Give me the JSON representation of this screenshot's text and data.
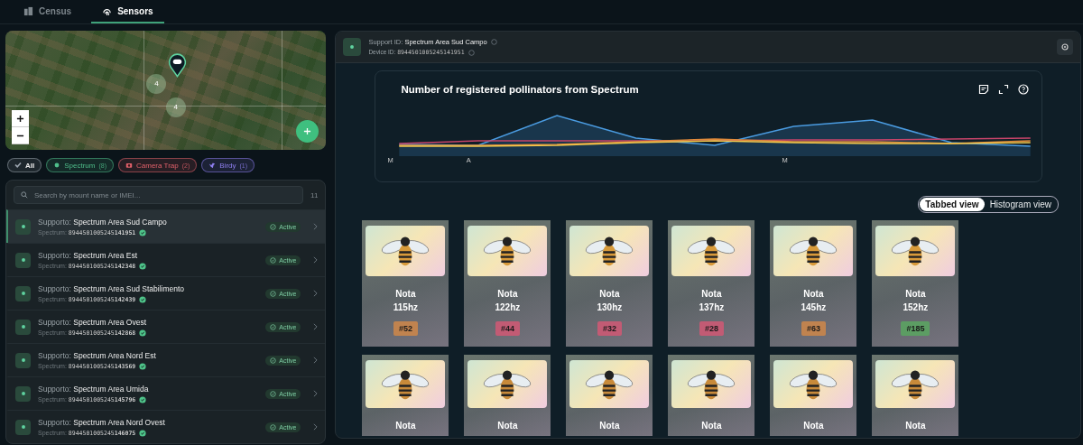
{
  "tabs": [
    {
      "label": "Census",
      "selected": false
    },
    {
      "label": "Sensors",
      "selected": true
    }
  ],
  "map": {
    "clusters": [
      "4",
      "4"
    ]
  },
  "filters": [
    {
      "label": "All",
      "selected": true,
      "kind": "all",
      "color": "#9aa3ad"
    },
    {
      "label": "Spectrum",
      "count": "(8)",
      "selected": false,
      "kind": "spectrum",
      "color": "#4fbf8a"
    },
    {
      "label": "Camera Trap",
      "count": "(2)",
      "selected": false,
      "kind": "camera",
      "color": "#e2616b"
    },
    {
      "label": "Birdy",
      "count": "(1)",
      "selected": false,
      "kind": "bird",
      "color": "#8f7ff0"
    }
  ],
  "search": {
    "placeholder": "Search by mount name or IMEI...",
    "count": "11"
  },
  "sensors": [
    {
      "prefix": "Supporto:",
      "name": "Spectrum Area Sud Campo",
      "type": "Spectrum:",
      "imei_head": "8944501005245",
      "imei_tail": "141951",
      "status": "Active",
      "selected": true
    },
    {
      "prefix": "Supporto:",
      "name": "Spectrum Area Est",
      "type": "Spectrum:",
      "imei_head": "8944501005245",
      "imei_tail": "142348",
      "status": "Active",
      "selected": false
    },
    {
      "prefix": "Supporto:",
      "name": "Spectrum Area Sud Stabilimento",
      "type": "Spectrum:",
      "imei_head": "8944501005245",
      "imei_tail": "142439",
      "status": "Active",
      "selected": false
    },
    {
      "prefix": "Supporto:",
      "name": "Spectrum Area Ovest",
      "type": "Spectrum:",
      "imei_head": "8944501005245",
      "imei_tail": "142868",
      "status": "Active",
      "selected": false
    },
    {
      "prefix": "Supporto:",
      "name": "Spectrum Area Nord Est",
      "type": "Spectrum:",
      "imei_head": "8944501005245",
      "imei_tail": "143569",
      "status": "Active",
      "selected": false
    },
    {
      "prefix": "Supporto:",
      "name": "Spectrum Area Umida",
      "type": "Spectrum:",
      "imei_head": "8944501005245",
      "imei_tail": "145796",
      "status": "Active",
      "selected": false
    },
    {
      "prefix": "Supporto:",
      "name": "Spectrum Area Nord Ovest",
      "type": "Spectrum:",
      "imei_head": "8944501005245",
      "imei_tail": "146075",
      "status": "Active",
      "selected": false
    }
  ],
  "detail": {
    "support_label": "Support ID:",
    "support_value": "Spectrum Area Sud Campo",
    "device_label": "Device ID:",
    "device_value": "8944501005245141951"
  },
  "chart": {
    "title": "Number of registered pollinators from Spectrum",
    "x_labels": [
      "M",
      "A",
      "M"
    ]
  },
  "views": [
    {
      "label": "Tabbed view",
      "selected": true
    },
    {
      "label": "Histogram view",
      "selected": false
    }
  ],
  "cards": [
    {
      "name": "Nota",
      "freq": "115hz",
      "count": "#52",
      "color": "#c0834f"
    },
    {
      "name": "Nota",
      "freq": "122hz",
      "count": "#44",
      "color": "#c25b74"
    },
    {
      "name": "Nota",
      "freq": "130hz",
      "count": "#32",
      "color": "#c25b74"
    },
    {
      "name": "Nota",
      "freq": "137hz",
      "count": "#28",
      "color": "#c25b74"
    },
    {
      "name": "Nota",
      "freq": "145hz",
      "count": "#63",
      "color": "#c0834f"
    },
    {
      "name": "Nota",
      "freq": "152hz",
      "count": "#185",
      "color": "#5c9d63"
    }
  ],
  "cards_row2": [
    {
      "name": "Nota"
    },
    {
      "name": "Nota"
    },
    {
      "name": "Nota"
    },
    {
      "name": "Nota"
    },
    {
      "name": "Nota"
    },
    {
      "name": "Nota"
    }
  ]
}
